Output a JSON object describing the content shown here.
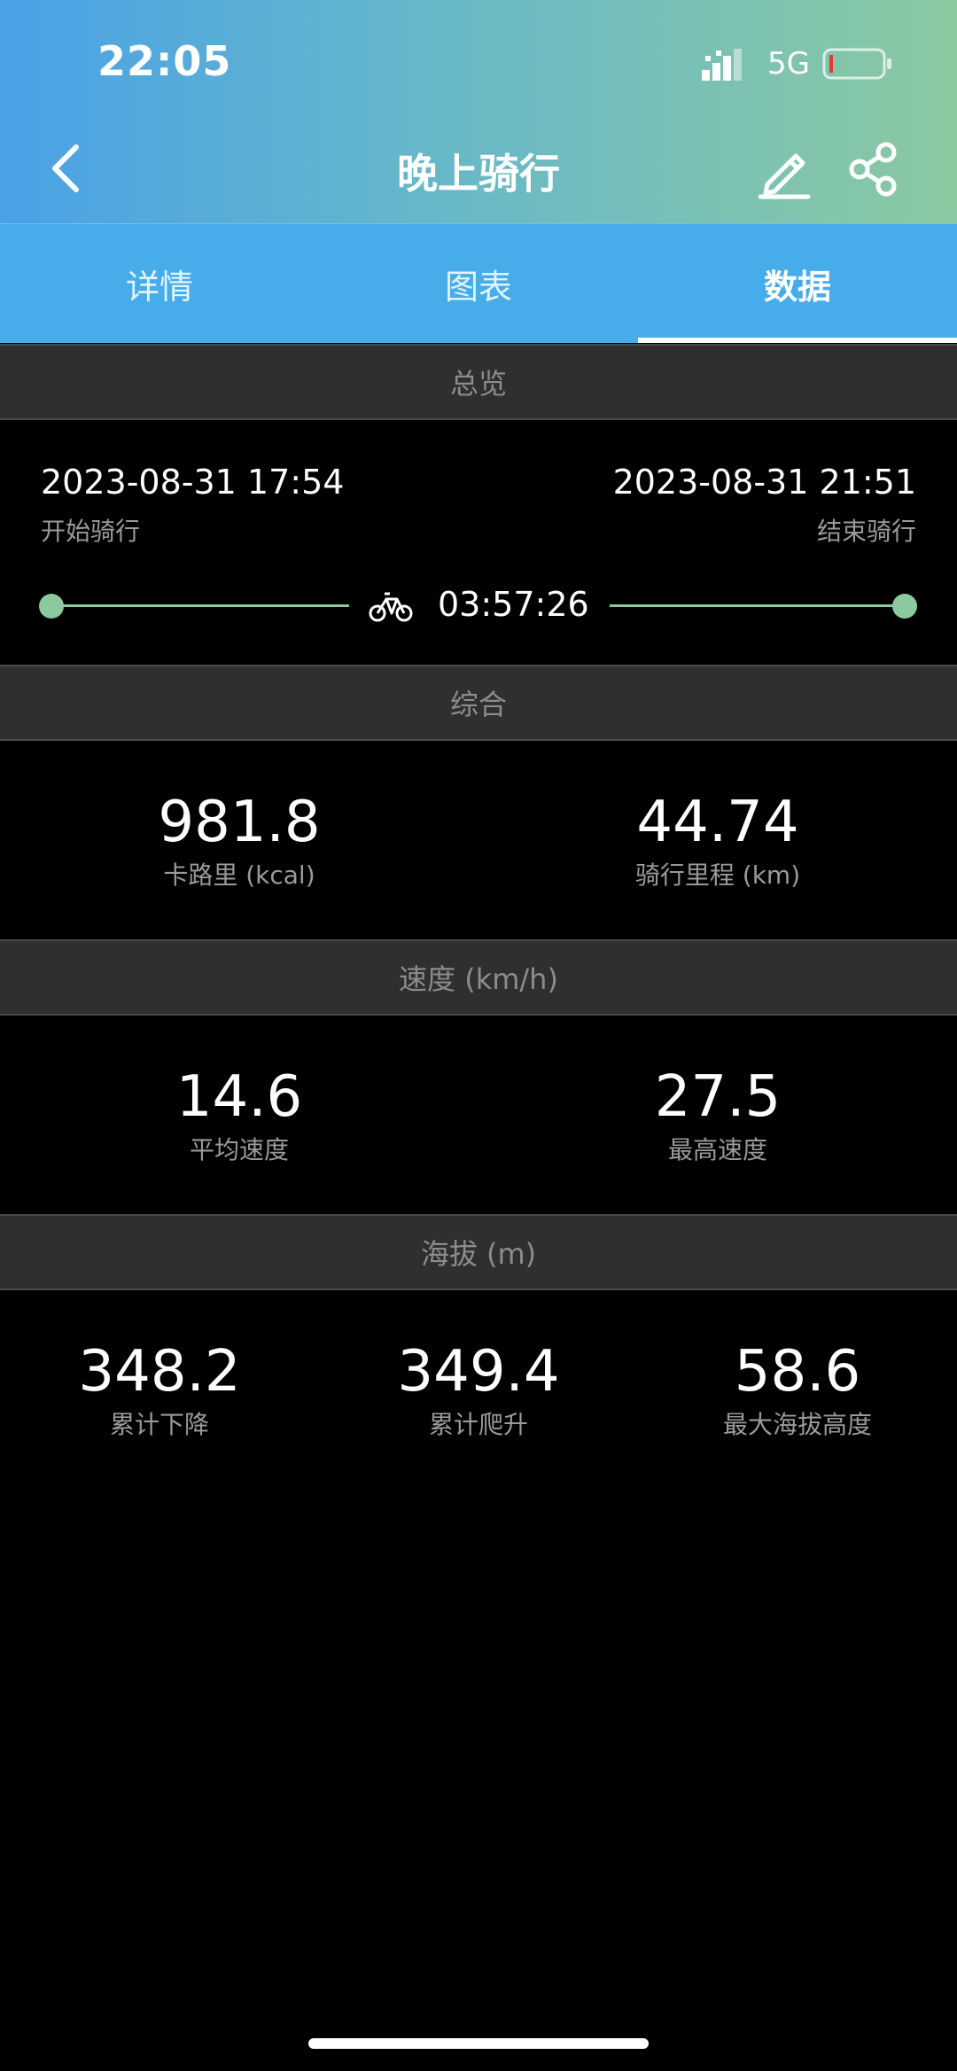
{
  "status_bar": {
    "time": "22:05",
    "network": "5G",
    "signal_icon": "signal-icon",
    "battery_icon": "battery-low-icon"
  },
  "header": {
    "title": "晚上骑行",
    "back_icon": "chevron-left-icon",
    "edit_icon": "edit-icon",
    "share_icon": "share-icon"
  },
  "tabs": [
    {
      "label": "详情",
      "active": false
    },
    {
      "label": "图表",
      "active": false
    },
    {
      "label": "数据",
      "active": true
    }
  ],
  "overview": {
    "header": "总览",
    "start_time": "2023-08-31 17:54",
    "start_label": "开始骑行",
    "end_time": "2023-08-31 21:51",
    "end_label": "结束骑行",
    "duration": "03:57:26",
    "duration_icon": "bicycle-icon"
  },
  "summary": {
    "header": "综合",
    "calories_value": "981.8",
    "calories_label": "卡路里 (kcal)",
    "distance_value": "44.74",
    "distance_label": "骑行里程 (km)"
  },
  "speed": {
    "header": "速度 (km/h)",
    "avg_value": "14.6",
    "avg_label": "平均速度",
    "max_value": "27.5",
    "max_label": "最高速度"
  },
  "altitude": {
    "header": "海拔 (m)",
    "descent_value": "348.2",
    "descent_label": "累计下降",
    "ascent_value": "349.4",
    "ascent_label": "累计爬升",
    "max_value": "58.6",
    "max_label": "最大海拔高度"
  },
  "colors": {
    "accent_green": "#8cc9a1",
    "tab_blue": "#46adea",
    "section_bg": "#2f2f2f"
  }
}
